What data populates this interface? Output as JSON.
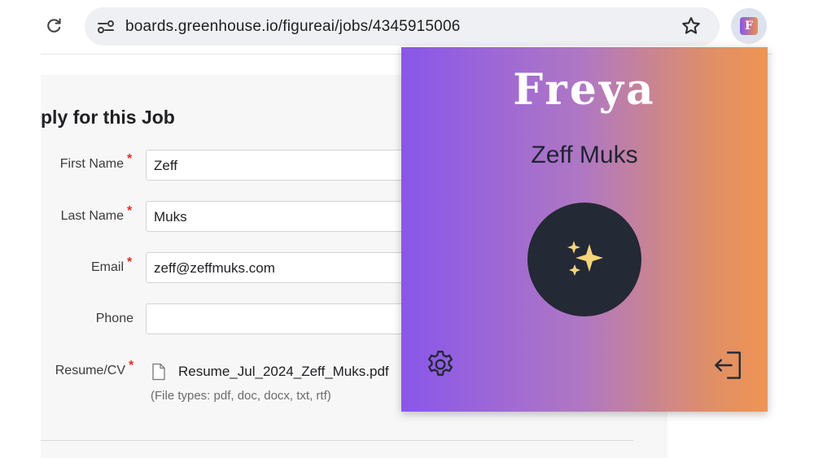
{
  "browser": {
    "url": "boards.greenhouse.io/figureai/jobs/4345915006",
    "icons": [
      "reload-icon",
      "site-settings-icon",
      "bookmark-star-icon",
      "extension-icon"
    ]
  },
  "form": {
    "title": "ply for this Job",
    "required_marker": "*",
    "fields": [
      {
        "label": "First Name",
        "value": "Zeff",
        "required": true
      },
      {
        "label": "Last Name",
        "value": "Muks",
        "required": true
      },
      {
        "label": "Email",
        "value": "zeff@zeffmuks.com",
        "required": true
      },
      {
        "label": "Phone",
        "value": "",
        "required": false
      }
    ],
    "resume": {
      "label": "Resume/CV",
      "filename": "Resume_Jul_2024_Zeff_Muks.pdf",
      "filetypes": "(File types: pdf, doc, docx, txt, rtf)"
    }
  },
  "extension": {
    "logo_letter": "F",
    "brand": "Freya",
    "user_name": "Zeff Muks",
    "colors": {
      "gradient_start": "#8956ea",
      "gradient_end": "#ef9453",
      "button": "#232935",
      "sparkle": "#f5d47a"
    },
    "icons": [
      "sparkles-icon",
      "settings-gear-icon",
      "logout-icon"
    ]
  }
}
